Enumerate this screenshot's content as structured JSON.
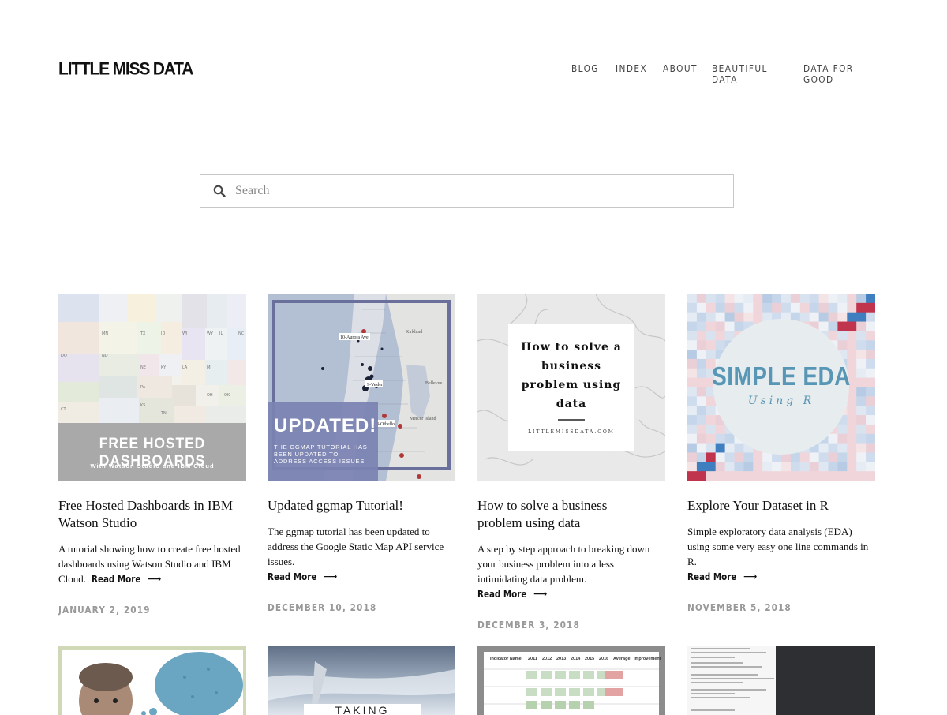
{
  "header": {
    "logo": "LITTLE MISS DATA",
    "nav": [
      "BLOG",
      "INDEX",
      "ABOUT",
      "BEAUTIFUL DATA",
      "DATA FOR GOOD"
    ]
  },
  "search": {
    "placeholder": "Search"
  },
  "posts": [
    {
      "title": "Free Hosted Dashboards in IBM Watson Studio",
      "excerpt": "A tutorial showing how to create free hosted dashboards using Watson Studio and IBM Cloud.",
      "read_more": "Read More",
      "date": "JANUARY 2, 2019",
      "thumb_title": "FREE HOSTED DASHBOARDS",
      "thumb_sub": "With Watson Studio and IBM Cloud"
    },
    {
      "title": "Updated ggmap Tutorial!",
      "excerpt": "The ggmap tutorial has been updated to address the Google Static Map API service issues.",
      "read_more": "Read More",
      "date": "DECEMBER 10, 2018",
      "thumb_title": "UPDATED!",
      "thumb_sub": "THE GGMAP TUTORIAL HAS BEEN UPDATED TO ADDRESS ACCESS ISSUES"
    },
    {
      "title": "How to solve a business problem using data",
      "excerpt": "A step by step approach to breaking down your business problem into a less intimidating data problem.",
      "read_more": "Read More",
      "date": "DECEMBER 3, 2018",
      "thumb_title": "How to solve a business problem using data",
      "thumb_sub": "LITTLEMISSDATA.COM"
    },
    {
      "title": "Explore Your Dataset in R",
      "excerpt": "Simple exploratory data analysis (EDA) using some very easy one line commands in R.",
      "read_more": "Read More",
      "date": "NOVEMBER 5, 2018",
      "thumb_title": "SIMPLE EDA",
      "thumb_sub": "Using R"
    }
  ],
  "bottom_row": {
    "taking_text": "TAKING",
    "table_headers": [
      "Indicator Name",
      "2011",
      "2012",
      "2013",
      "2014",
      "2015",
      "2016",
      "Average",
      "Improvement"
    ]
  }
}
